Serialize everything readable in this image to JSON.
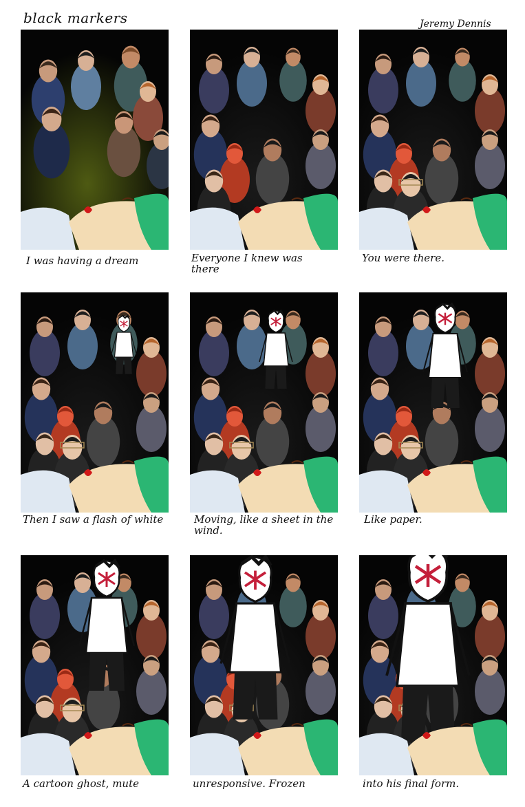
{
  "header": {
    "title": "black markers",
    "author": "Jeremy Dennis"
  },
  "panels": [
    {
      "caption": "I was having a dream",
      "ghost": 0
    },
    {
      "caption": "Everyone I knew was there",
      "ghost": 0
    },
    {
      "caption": "You were there.",
      "ghost": 0
    },
    {
      "caption": "Then I saw a flash of white",
      "ghost": 1
    },
    {
      "caption": "Moving, like a sheet in the wind.",
      "ghost": 2
    },
    {
      "caption": "Like paper.",
      "ghost": 3
    },
    {
      "caption": "A cartoon ghost, mute",
      "ghost": 4
    },
    {
      "caption": "unresponsive. Frozen",
      "ghost": 5
    },
    {
      "caption": "into his final form.",
      "ghost": 6
    }
  ],
  "colors": {
    "background": "#ffffff",
    "panel_bg": "#050505",
    "sleeper_hair": "#2bb673",
    "sleeper_skin": "#f3dcb4",
    "lips": "#d11a1a",
    "pillow": "#dfe8f2"
  }
}
